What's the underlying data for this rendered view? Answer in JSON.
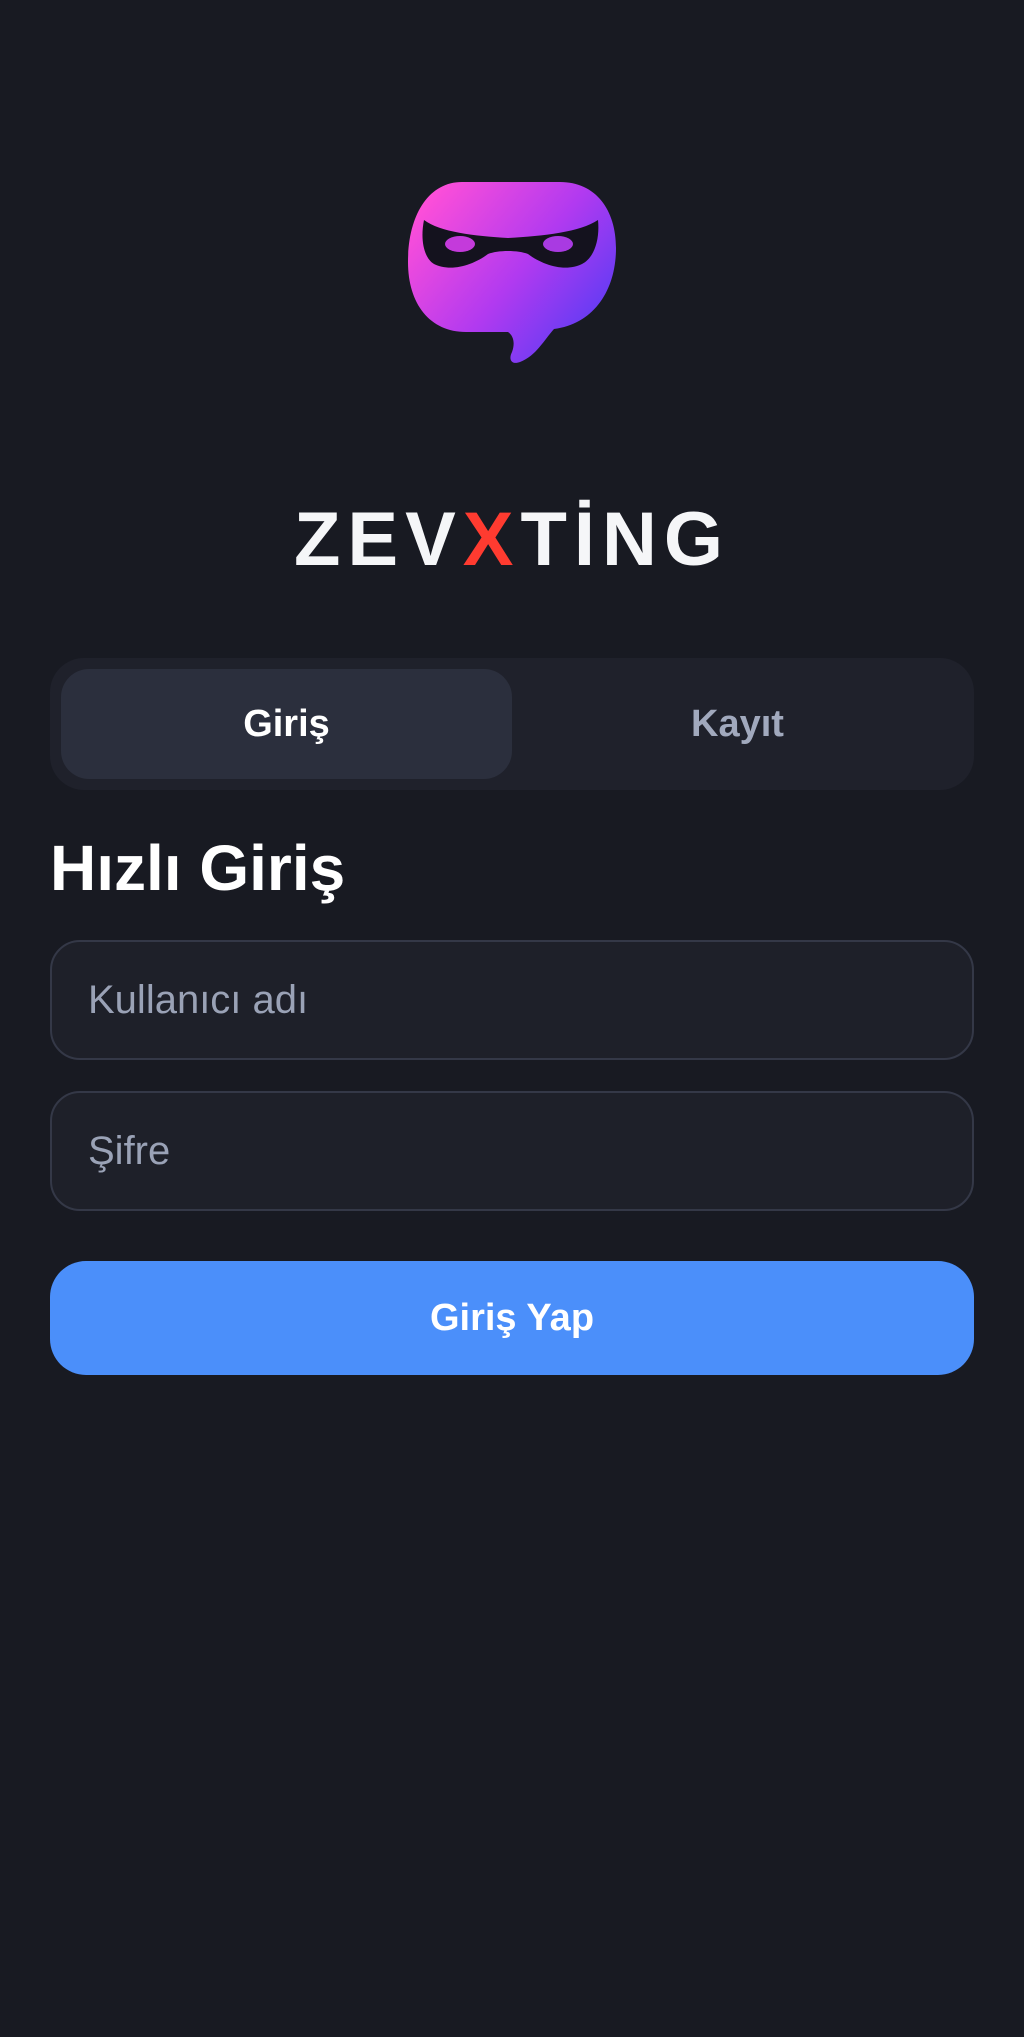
{
  "logo": {
    "icon": "mask-chat-bubble-icon",
    "gradient_start": "#ff4fd8",
    "gradient_end": "#4a3cf5"
  },
  "brand": {
    "prefix": "ZEV",
    "accent": "X",
    "suffix": "TİNG",
    "accent_color": "#ff3b30"
  },
  "tabs": [
    {
      "label": "Giriş",
      "active": true
    },
    {
      "label": "Kayıt",
      "active": false
    }
  ],
  "login": {
    "title": "Hızlı Giriş",
    "username_placeholder": "Kullanıcı adı",
    "username_value": "",
    "password_placeholder": "Şifre",
    "password_value": "",
    "submit_label": "Giriş Yap"
  },
  "colors": {
    "background": "#181a22",
    "primary": "#4b8ffa",
    "tab_active": "#2b2f3d",
    "tab_inactive_text": "#a1a9bd"
  }
}
